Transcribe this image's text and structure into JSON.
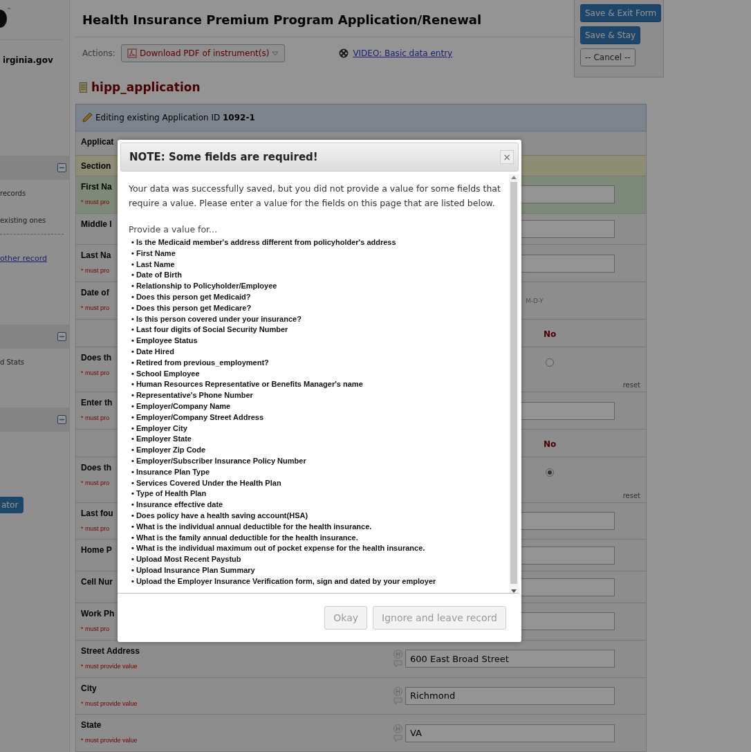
{
  "sidebar": {
    "trademark": "™",
    "site": "irginia.gov",
    "sections": [
      {
        "expanded": true,
        "items": [
          {
            "kind": "text",
            "text": "records"
          },
          {
            "kind": "text",
            "text": "existing ones"
          },
          {
            "kind": "link",
            "text": "other record"
          }
        ]
      },
      {
        "expanded": true,
        "items": [
          {
            "kind": "text",
            "text": "d Stats"
          }
        ]
      },
      {
        "expanded": true,
        "items": [
          {
            "kind": "button",
            "text": "ator"
          }
        ]
      }
    ]
  },
  "header": {
    "title": "Health Insurance Premium Program Application/Renewal",
    "actions_label": "Actions:",
    "download": "Download PDF of instrument(s)",
    "video_link": "VIDEO: Basic data entry"
  },
  "save_panel": {
    "buttons": [
      {
        "kind": "primary",
        "label": "Save & Exit Form"
      },
      {
        "kind": "primary",
        "label": "Save & Stay"
      },
      {
        "kind": "default",
        "label": "-- Cancel --"
      }
    ]
  },
  "form": {
    "instrument": "hipp_application",
    "banner": "Editing existing Application ID **1092-1**",
    "rows": [
      {
        "kind": "plain",
        "label": "Applicat",
        "highlighted": false
      },
      {
        "kind": "section",
        "label": "Section",
        "highlighted": false
      },
      {
        "kind": "input",
        "label": "First Na",
        "note": "* must pro",
        "highlighted": true
      },
      {
        "kind": "input",
        "label": "Middle I",
        "highlighted": false
      },
      {
        "kind": "input",
        "label": "Last Na",
        "note": "* must pro",
        "highlighted": false
      },
      {
        "kind": "date",
        "label": "Date of",
        "note": "* must pro",
        "format": "M-D-Y",
        "highlighted": false
      },
      {
        "kind": "radio_header",
        "option": "No",
        "highlighted": false
      },
      {
        "kind": "radio",
        "label": "Does th",
        "note": "* must pro",
        "checked": false,
        "reset": "reset",
        "highlighted": false
      },
      {
        "kind": "input",
        "label": "Enter th",
        "note": "* must pro",
        "highlighted": false
      },
      {
        "kind": "radio_header",
        "option": "No",
        "highlighted": false
      },
      {
        "kind": "radio",
        "label": "Does th",
        "note": "* must pro",
        "checked": true,
        "reset": "reset",
        "highlighted": false
      },
      {
        "kind": "input",
        "label": "Last fou",
        "note": "* must pro",
        "highlighted": false
      },
      {
        "kind": "input",
        "label": "Home P",
        "highlighted": false
      },
      {
        "kind": "input",
        "label": "Cell Nur",
        "highlighted": false
      },
      {
        "kind": "input",
        "label": "Work Ph",
        "note": "* must pro",
        "highlighted": false
      },
      {
        "kind": "input_with_help",
        "label": "Street Address",
        "note": "* must provide value",
        "value": "600 East Broad Street",
        "highlighted": false
      },
      {
        "kind": "input_with_help",
        "label": "City",
        "note": "* must provide value",
        "value": "Richmond",
        "highlighted": false
      },
      {
        "kind": "input_with_help",
        "label": "State",
        "note": "* must provide value",
        "value": "VA",
        "highlighted": false
      }
    ]
  },
  "dialog": {
    "title": "NOTE: Some fields are required!",
    "close": "×",
    "message": "Your data was successfully saved, but you did not provide a value for some fields that require a value. Please enter a value for the fields on this page that are listed below.",
    "list_intro": "Provide a value for...",
    "fields": [
      "• Is the Medicaid member's address different from policyholder's address",
      "• First Name",
      "• Last Name",
      "• Date of Birth",
      "• Relationship to Policyholder/Employee",
      "• Does this person get Medicaid?",
      "• Does this person get Medicare?",
      "• Is this person covered under your insurance?",
      "• Last four digits of Social Security Number",
      "• Employee Status",
      "• Date Hired",
      "• Retired from previous_employment?",
      "• School Employee",
      "• Human Resources Representative or Benefits Manager's name",
      "• Representative's Phone Number",
      "• Employer/Company Name",
      "• Employer/Company Street Address",
      "• Employer City",
      "• Employer State",
      "• Employer Zip Code",
      "• Employer/Subscriber Insurance Policy Number",
      "• Insurance Plan Type",
      "• Services Covered Under the Health Plan",
      "• Type of Health Plan",
      "• Insurance effective date",
      "• Does policy have a health saving account(HSA)",
      "• What is the individual annual deductible for the health insurance.",
      "• What is the family annual deductible for the health insurance.",
      "• What is the individual maximum out of pocket expense for the health insurance.",
      "• Upload Most Recent Paystub",
      "• Upload Insurance Plan Summary",
      "• Upload the Employer Insurance Verification form, sign and dated by your employer"
    ],
    "buttons": [
      "Okay",
      "Ignore and leave record"
    ]
  }
}
